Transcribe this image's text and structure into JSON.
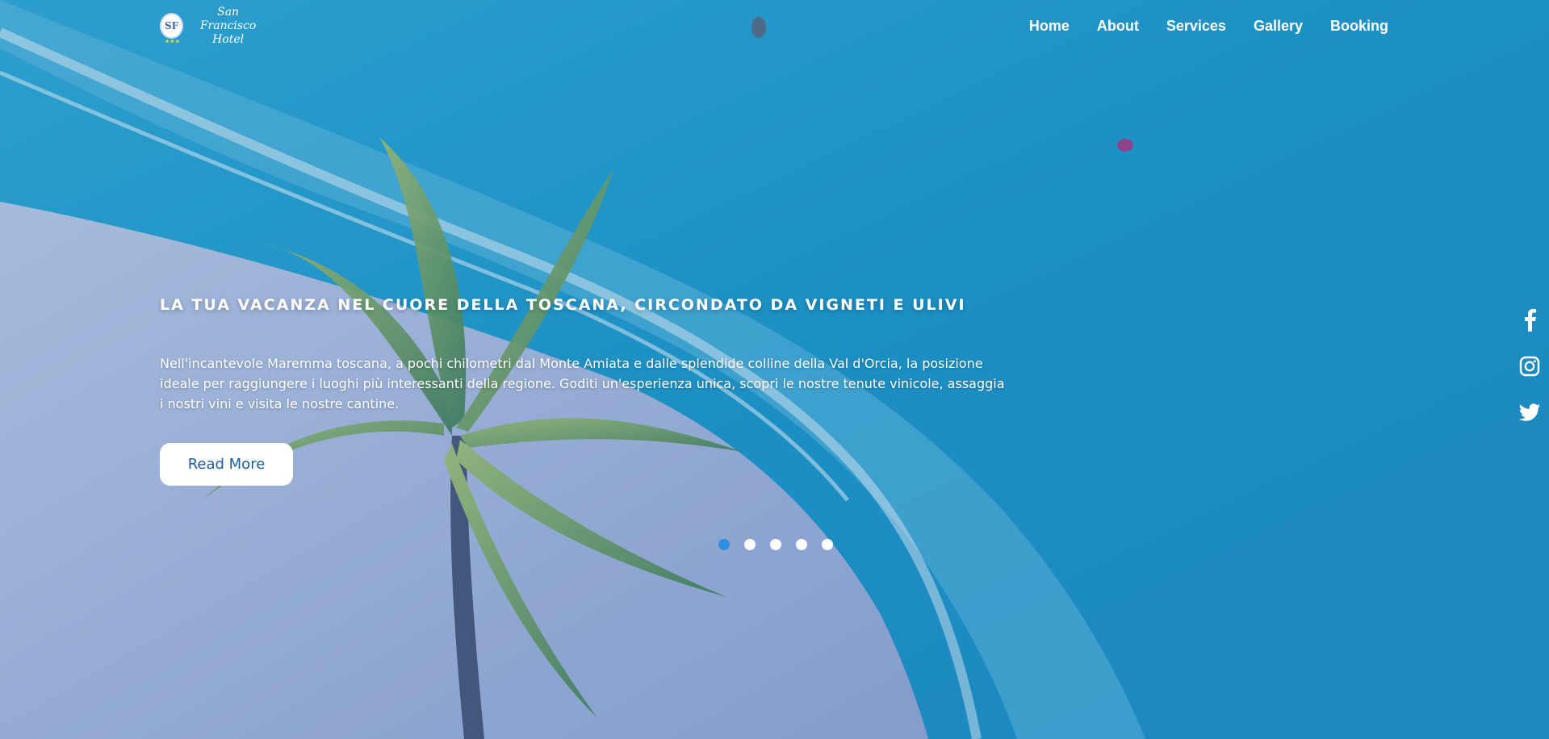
{
  "brand": {
    "logo_initials": "SF",
    "name_line1": "San Francisco",
    "name_line2": "Hotel",
    "stars": "★★★"
  },
  "nav": {
    "items": [
      {
        "label": "Home"
      },
      {
        "label": "About"
      },
      {
        "label": "Services"
      },
      {
        "label": "Gallery"
      },
      {
        "label": "Booking"
      }
    ]
  },
  "hero": {
    "headline": "LA TUA VACANZA NEL CUORE DELLA TOSCANA, CIRCONDATO DA VIGNETI E ULIVI",
    "description": "Nell'incantevole Maremma toscana, a pochi chilometri dal Monte Amiata e dalle splendide colline della Val d'Orcia, la posizione ideale per raggiungere i luoghi più interessanti della regione. Goditi un'esperienza unica, scopri le nostre tenute vinicole, assaggia i nostri vini e visita le nostre cantine.",
    "cta_label": "Read More"
  },
  "slider": {
    "count": 5,
    "active_index": 0,
    "active_color": "#2e8fe0"
  },
  "social": [
    {
      "icon": "facebook-icon"
    },
    {
      "icon": "instagram-icon"
    },
    {
      "icon": "twitter-icon"
    }
  ]
}
